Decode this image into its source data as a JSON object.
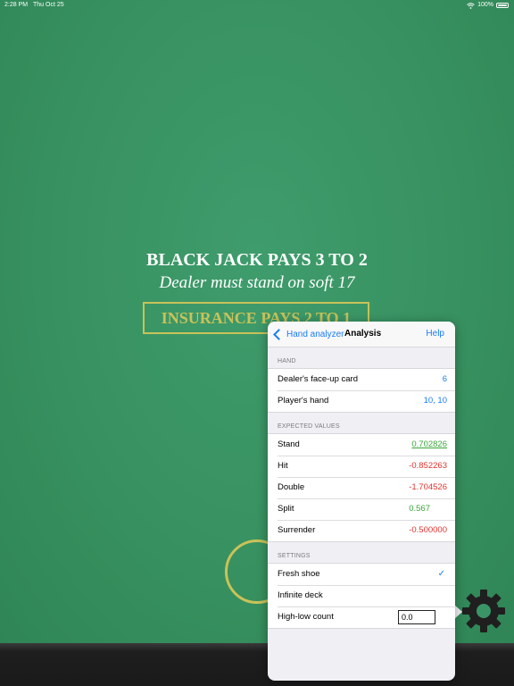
{
  "status_bar": {
    "time": "2:28 PM",
    "date": "Thu Oct 25",
    "battery": "100%"
  },
  "table": {
    "line1": "BLACK JACK PAYS 3 TO 2",
    "line2": "Dealer must stand on soft 17",
    "insurance": "INSURANCE PAYS 2 TO 1"
  },
  "popover": {
    "back_label": "Hand analyzer",
    "title": "Analysis",
    "help_label": "Help",
    "hand_section": {
      "header": "HAND",
      "rows": [
        {
          "label": "Dealer's face-up card",
          "value": "6"
        },
        {
          "label": "Player's hand",
          "value": "10, 10"
        }
      ]
    },
    "ev_section": {
      "header": "EXPECTED VALUES",
      "rows": [
        {
          "label": "Stand",
          "value": "0.702826"
        },
        {
          "label": "Hit",
          "value": "-0.852263"
        },
        {
          "label": "Double",
          "value": "-1.704526"
        },
        {
          "label": "Split",
          "value": "0.567"
        },
        {
          "label": "Surrender",
          "value": "-0.500000"
        }
      ]
    },
    "settings_section": {
      "header": "SETTINGS",
      "fresh_shoe": "Fresh shoe",
      "fresh_shoe_check": "✓",
      "infinite_deck": "Infinite deck",
      "high_low_label": "High-low count",
      "high_low_value": "0.0"
    }
  },
  "colors": {
    "felt": "#3a9566",
    "accent": "#1a7cf5",
    "positive": "#3aa63a",
    "negative": "#e0352f",
    "gold": "#c9c25a"
  },
  "icons": {
    "settings": "gear-icon",
    "back": "chevron-left-icon",
    "wifi": "wifi-icon",
    "battery": "battery-icon"
  }
}
